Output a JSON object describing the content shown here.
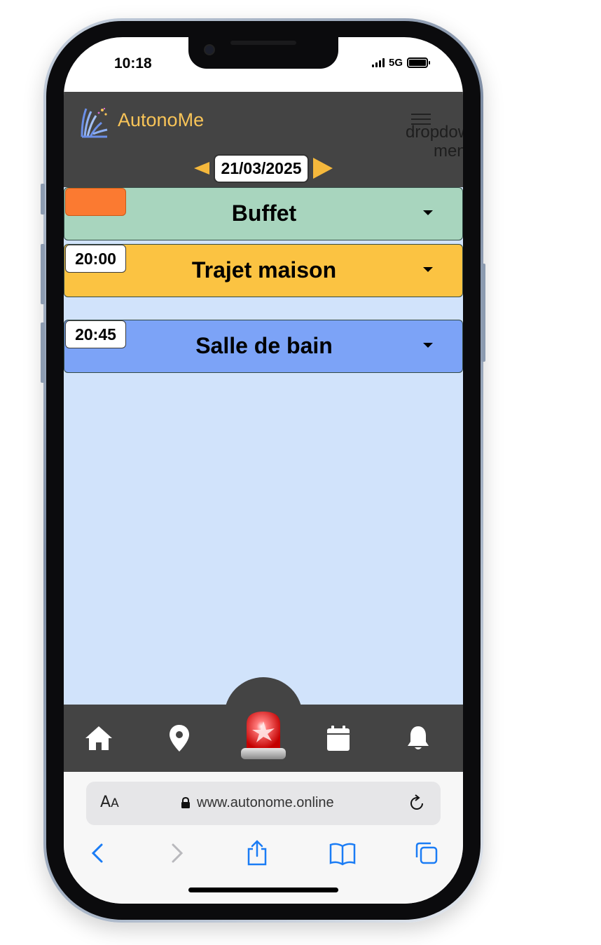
{
  "status_bar": {
    "time": "10:18",
    "network": "5G"
  },
  "header": {
    "app_name": "AutonoMe",
    "menu_fallback_text": "dropdown menu",
    "date": "21/03/2025"
  },
  "events": [
    {
      "time": "",
      "title": "Buffet",
      "color": "#a8d5be",
      "time_pending": true
    },
    {
      "time": "20:00",
      "title": "Trajet maison",
      "color": "#fbc342",
      "time_pending": false
    },
    {
      "time": "20:45",
      "title": "Salle de bain",
      "color": "#7ca3f7",
      "time_pending": false
    }
  ],
  "bottom_nav": {
    "items": [
      "home-icon",
      "location-pin-icon",
      "alarm-siren-icon",
      "calendar-icon",
      "bell-icon"
    ]
  },
  "browser": {
    "text_size_label_big": "A",
    "text_size_label_small": "A",
    "url": "www.autonome.online"
  },
  "colors": {
    "header_bg": "#444444",
    "accent": "#f8c458",
    "content_bg": "#d1e3fb",
    "browser_tint": "#1a7cf5"
  }
}
